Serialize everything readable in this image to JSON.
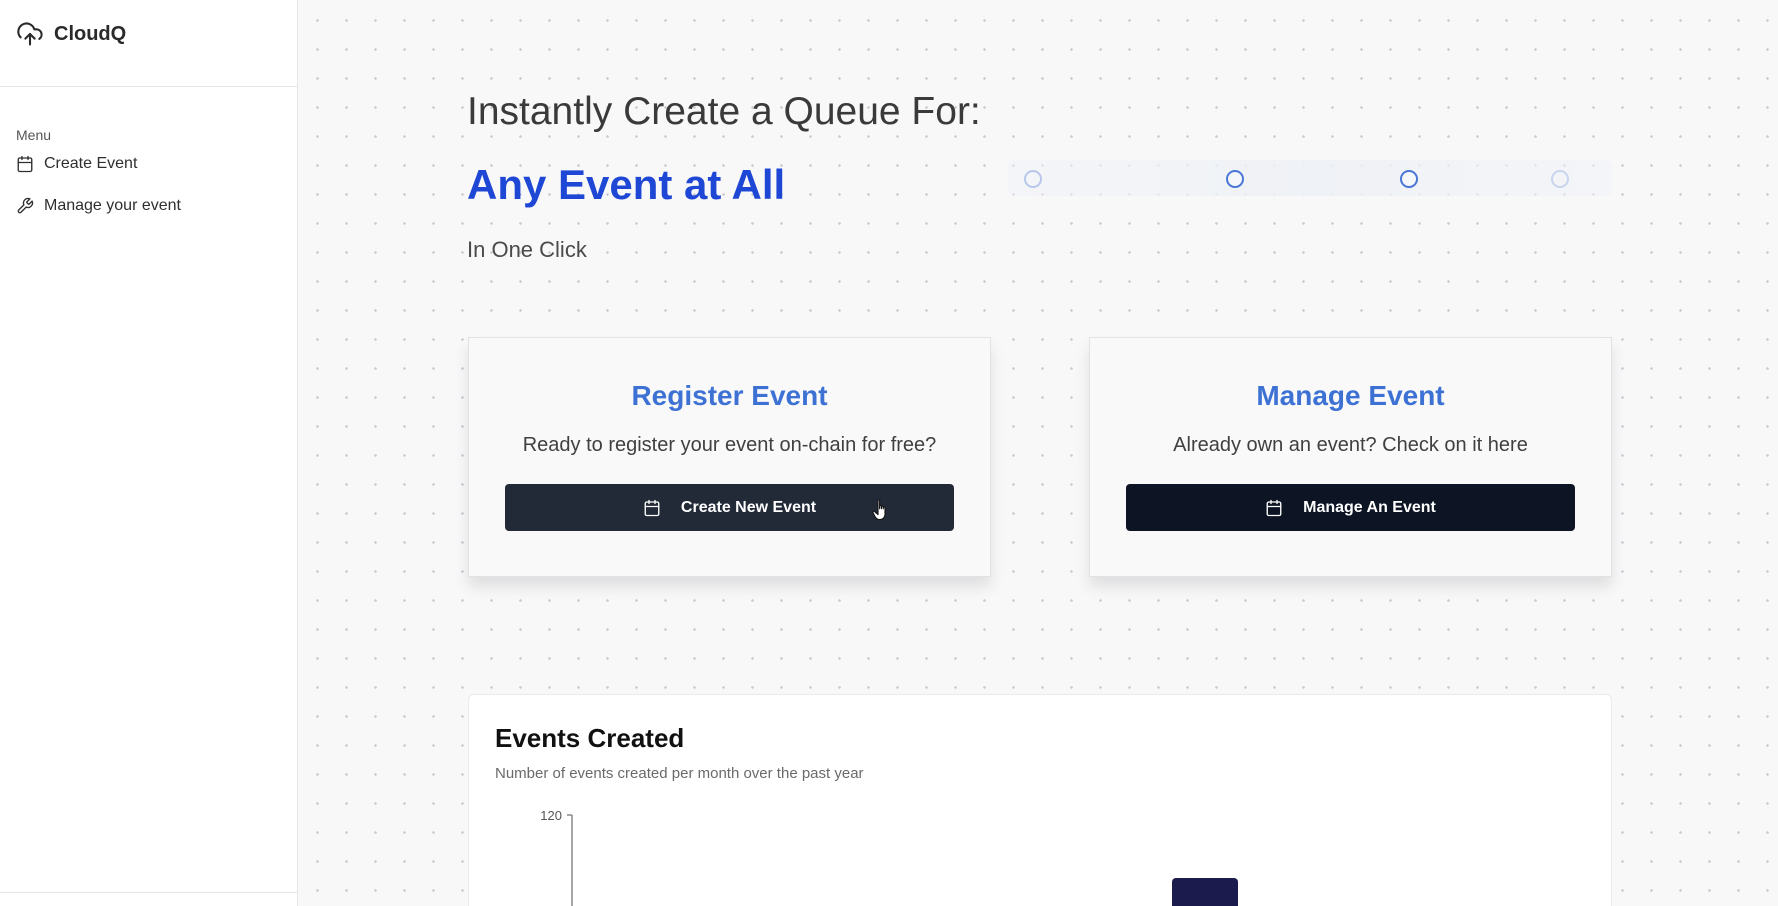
{
  "app": {
    "name": "CloudQ",
    "logo_icon": "cloud-upload-icon"
  },
  "sidebar": {
    "menu_label": "Menu",
    "items": [
      {
        "label": "Create Event",
        "icon": "calendar-icon"
      },
      {
        "label": "Manage your event",
        "icon": "wrench-icon"
      }
    ]
  },
  "hero": {
    "title": "Instantly Create a Queue For:",
    "accent": "Any Event at All",
    "subtitle": "In One Click"
  },
  "cards": {
    "register": {
      "title": "Register Event",
      "text": "Ready to register your event on-chain for free?",
      "button": "Create New Event",
      "button_icon": "calendar-icon"
    },
    "manage": {
      "title": "Manage Event",
      "text": "Already own an event? Check on it here",
      "button": "Manage An Event",
      "button_icon": "calendar-icon"
    }
  },
  "colors": {
    "accent_blue": "#1f47d6",
    "card_title_blue": "#3d72d4",
    "button_dark": "#222a38",
    "bar_color": "#1c1b4d"
  },
  "chart": {
    "title": "Events Created",
    "subtitle": "Number of events created per month over the past year"
  },
  "chart_data": {
    "type": "bar",
    "title": "Events Created",
    "subtitle": "Number of events created per month over the past year",
    "y_tick_labels": [
      "120"
    ],
    "visible_bar_count": 1
  }
}
